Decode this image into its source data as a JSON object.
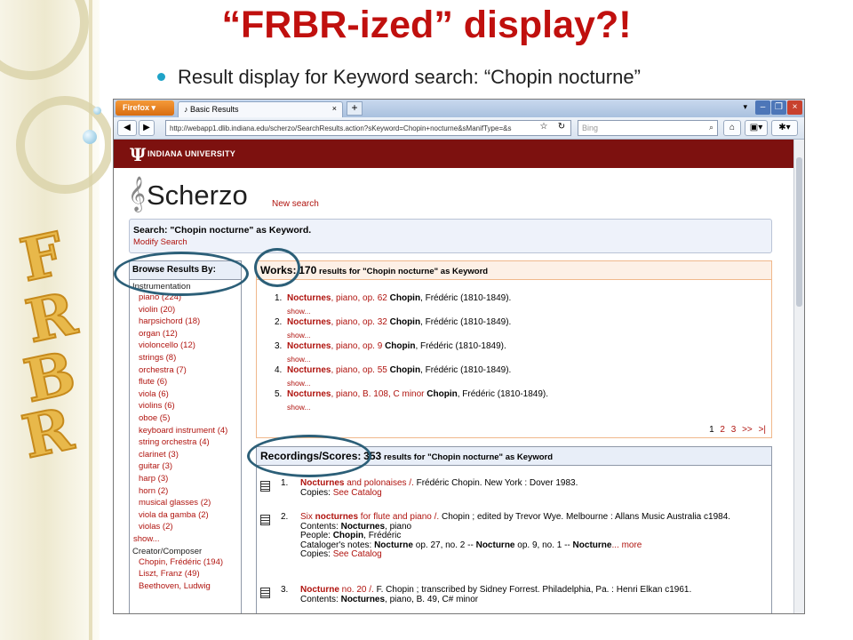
{
  "slide": {
    "title": "“FRBR-ized” display?!",
    "bullet": "Result display for Keyword search: “Chopin nocturne”",
    "deco_letters": [
      "F",
      "R",
      "B",
      "R"
    ]
  },
  "browser": {
    "firefox_label": "Firefox ▾",
    "tab_title": "Basic Results",
    "tab_close": "×",
    "new_tab": "+",
    "url": "http://webapp1.dlib.indiana.edu/scherzo/SearchResults.action?sKeyword=Chopin+nocturne&sManifType=&s",
    "search_engine": "Bing",
    "back": "◀",
    "forward": "▶",
    "star": "☆",
    "reload": "↻",
    "home": "⌂",
    "search_glass": "⌕"
  },
  "iu": {
    "mark": "Ψ",
    "name": "INDIANA UNIVERSITY"
  },
  "scherzo": {
    "clef": "𝄞",
    "logo": "Scherzo",
    "new_search": "New search",
    "search_text": "Search: \"Chopin nocturne\" as Keyword.",
    "modify": "Modify Search"
  },
  "browse": {
    "header": "Browse Results By:",
    "sections": [
      {
        "title": "Instrumentation",
        "items": [
          "piano (224)",
          "violin (20)",
          "harpsichord (18)",
          "organ (12)",
          "violoncello (12)",
          "strings (8)",
          "orchestra (7)",
          "flute (6)",
          "viola (6)",
          "violins (6)",
          "oboe (5)",
          "keyboard instrument (4)",
          "string orchestra (4)",
          "clarinet (3)",
          "guitar (3)",
          "harp (3)",
          "horn (2)",
          "musical glasses (2)",
          "viola da gamba (2)",
          "violas (2)"
        ],
        "show": "show..."
      },
      {
        "title": "Creator/Composer",
        "items": [
          "Chopin, Frédéric (194)",
          "Liszt, Franz (49)",
          "Beethoven, Ludwig"
        ]
      }
    ]
  },
  "works": {
    "label": "Works:",
    "count": "170",
    "suffix": "results for \"Chopin nocturne\" as Keyword",
    "rows": [
      {
        "num": "1.",
        "title": "Nocturnes",
        "detail": ", piano, op. 62",
        "composer": "Chopin",
        "dates": ", Frédéric (1810-1849).",
        "show": "show..."
      },
      {
        "num": "2.",
        "title": "Nocturnes",
        "detail": ", piano, op. 32",
        "composer": "Chopin",
        "dates": ", Frédéric (1810-1849).",
        "show": "show..."
      },
      {
        "num": "3.",
        "title": "Nocturnes",
        "detail": ", piano, op. 9",
        "composer": "Chopin",
        "dates": ", Frédéric (1810-1849).",
        "show": "show..."
      },
      {
        "num": "4.",
        "title": "Nocturnes",
        "detail": ", piano, op. 55",
        "composer": "Chopin",
        "dates": ", Frédéric (1810-1849).",
        "show": "show..."
      },
      {
        "num": "5.",
        "title": "Nocturnes",
        "detail": ", piano, B. 108, C minor",
        "composer": "Chopin",
        "dates": ", Frédéric (1810-1849).",
        "show": "show..."
      }
    ],
    "pager": [
      "1",
      "2",
      "3",
      ">>",
      ">|"
    ]
  },
  "recs": {
    "label": "Recordings/Scores:",
    "count": "353",
    "suffix": "results for \"Chopin nocturne\" as Keyword",
    "r1": {
      "num": "1.",
      "title_bold": "Nocturnes",
      "title_rest": " and polonaises /.",
      "text": " Frédéric Chopin. New York : Dover 1983.",
      "copies": "Copies:",
      "catalog": "See Catalog"
    },
    "r2": {
      "num": "2.",
      "title_pre": "Six ",
      "title_bold": "nocturnes",
      "title_rest": " for flute and piano /.",
      "text": " Chopin ; edited by Trevor Wye. Melbourne : Allans Music Australia c1984.",
      "contents_label": "Contents: ",
      "contents_bold": "Nocturnes",
      "contents_rest": ", piano",
      "people_label": "People: ",
      "people_bold": "Chopin",
      "people_rest": ", Frédéric",
      "notes_label": "Cataloger's notes: ",
      "notes_b1": "Nocturne",
      "notes_mid": " op. 27, no. 2 -- ",
      "notes_b2": "Nocturne",
      "notes_end": " op. 9, no. 1 -- ",
      "notes_b3": "Nocturne",
      "more": "... more",
      "copies": "Copies:",
      "catalog": "See Catalog"
    },
    "r3": {
      "num": "3.",
      "title_bold": "Nocturne",
      "title_rest": " no. 20 /.",
      "text": " F. Chopin ; transcribed by Sidney Forrest. Philadelphia, Pa. : Henri Elkan c1961.",
      "contents_label": "Contents: ",
      "contents_bold": "Nocturnes",
      "contents_rest": ", piano, B. 49, C# minor"
    }
  }
}
